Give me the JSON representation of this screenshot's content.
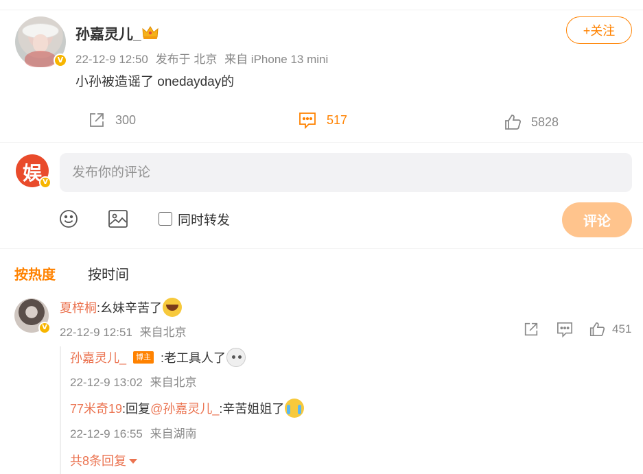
{
  "post": {
    "author": "孙嘉灵儿_",
    "verified_badge": "V",
    "time": "22-12-9 12:50",
    "location": "发布于 北京",
    "device": "来自 iPhone 13 mini",
    "text": "小孙被造谣了 onedayday的",
    "follow_label": "+关注",
    "repost_count": "300",
    "comment_count": "517",
    "like_count": "5828"
  },
  "composer": {
    "avatar_glyph": "娱",
    "placeholder": "发布你的评论",
    "repost_label": "同时转发",
    "submit_label": "评论"
  },
  "sort_tabs": {
    "hot": "按热度",
    "time": "按时间"
  },
  "comments": [
    {
      "user": "夏梓桐",
      "text": ":幺妹辛苦了",
      "time": "22-12-9 12:51",
      "source": "来自北京",
      "like_count": "451",
      "replies": [
        {
          "user": "孙嘉灵儿_",
          "tag": "博主",
          "text": ":老工具人了",
          "time": "22-12-9 13:02",
          "source": "来自北京"
        },
        {
          "user": "77米奇19",
          "reply_prefix": ":回复",
          "mention": "@孙嘉灵儿_",
          "text": ":辛苦姐姐了",
          "time": "22-12-9 16:55",
          "source": "来自湖南"
        }
      ],
      "more_replies": "共8条回复"
    }
  ],
  "colors": {
    "accent": "#ff8200",
    "username": "#eb7350",
    "meta": "#888888",
    "verified": "#f7b500"
  },
  "icons": [
    "crown-icon",
    "repost-icon",
    "comment-icon",
    "like-icon",
    "emoji-icon",
    "image-icon",
    "verified-icon"
  ]
}
